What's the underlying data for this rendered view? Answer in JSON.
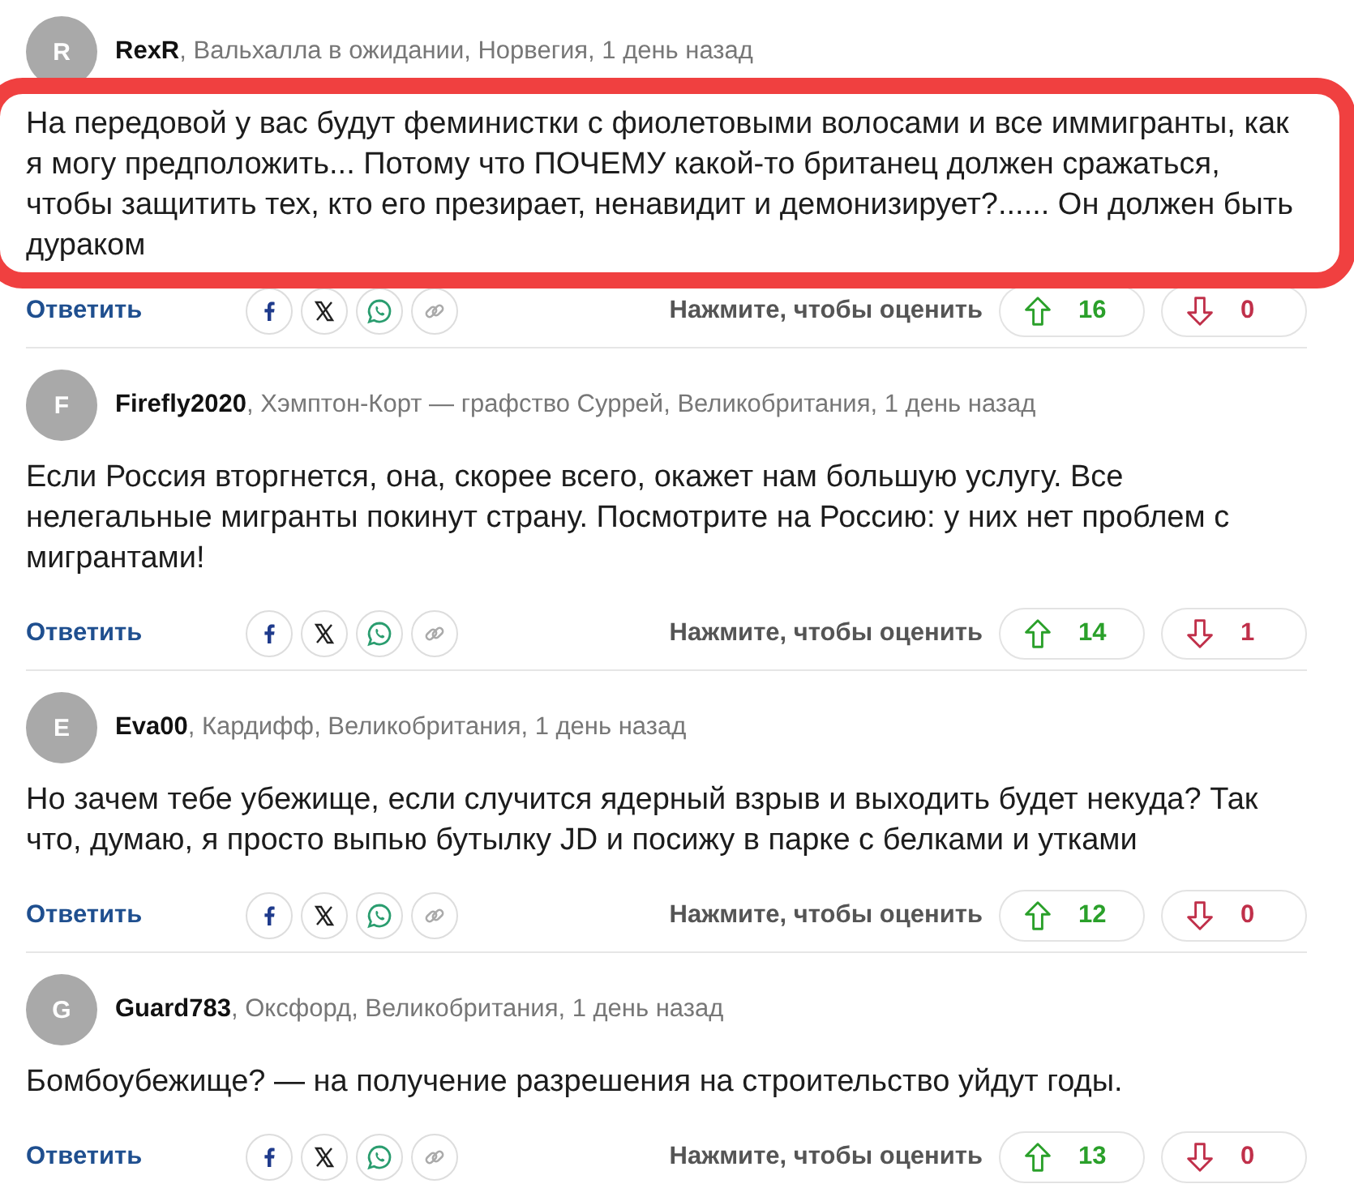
{
  "comments": [
    {
      "avatar": "R",
      "author": "RexR",
      "meta": ", Вальхалла в ожидании, Норвегия, 1 день назад",
      "body": "На передовой у вас будут феминистки с фиолетовыми волосами и все иммигранты, как я могу предположить... Потому что ПОЧЕМУ какой-то британец должен сражаться, чтобы защитить тех, кто его презирает, ненавидит и демонизирует?...... Он должен быть дураком",
      "highlighted": true,
      "reply": "Ответить",
      "rate_label": "Нажмите, чтобы оценить",
      "up": "16",
      "down": "0"
    },
    {
      "avatar": "F",
      "author": "Firefly2020",
      "meta": ", Хэмптон-Корт — графство Суррей, Великобритания, 1 день назад",
      "body": "Если Россия вторгнется, она, скорее всего, окажет нам большую услугу. Все нелегальные мигранты покинут страну. Посмотрите на Россию: у них нет проблем с мигрантами!",
      "highlighted": false,
      "reply": "Ответить",
      "rate_label": "Нажмите, чтобы оценить",
      "up": "14",
      "down": "1"
    },
    {
      "avatar": "E",
      "author": "Eva00",
      "meta": ", Кардифф, Великобритания, 1 день назад",
      "body": "Но зачем тебе убежище, если случится ядерный взрыв и выходить будет некуда? Так что, думаю, я просто выпью бутылку JD и посижу в парке с белками и утками",
      "highlighted": false,
      "reply": "Ответить",
      "rate_label": "Нажмите, чтобы оценить",
      "up": "12",
      "down": "0"
    },
    {
      "avatar": "G",
      "author": "Guard783",
      "meta": ", Оксфорд, Великобритания, 1 день назад",
      "body": "Бомбоубежище? — на получение разрешения на строительство уйдут годы.",
      "highlighted": false,
      "reply": "Ответить",
      "rate_label": "Нажмите, чтобы оценить",
      "up": "13",
      "down": "0"
    }
  ]
}
